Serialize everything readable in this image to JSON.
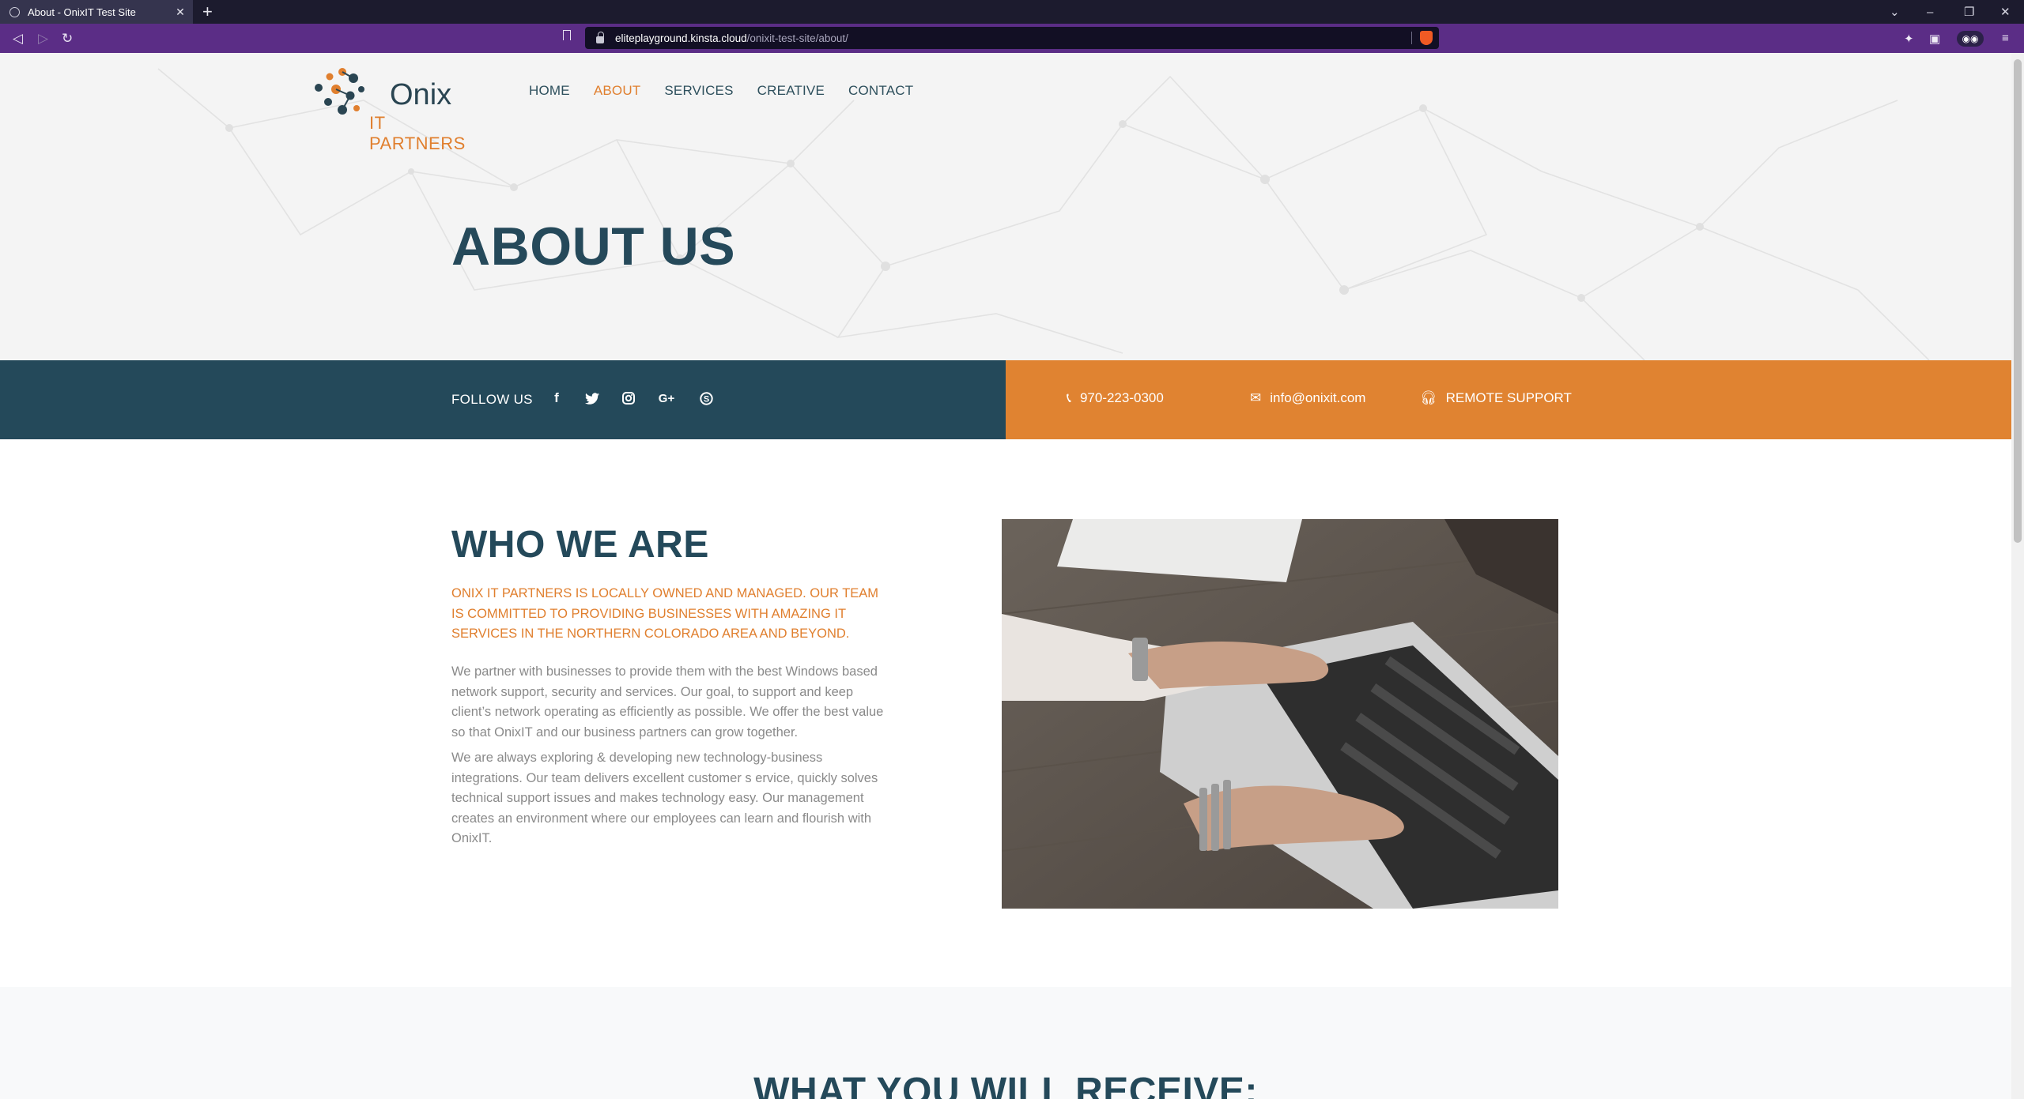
{
  "browser": {
    "tab_title": "About - OnixIT Test Site",
    "url_host": "eliteplayground.kinsta.cloud",
    "url_path": "/onixit-test-site/about/"
  },
  "logo": {
    "word1": "Onix",
    "word2": "IT PARTNERS"
  },
  "nav": {
    "items": [
      "HOME",
      "ABOUT",
      "SERVICES",
      "CREATIVE",
      "CONTACT"
    ],
    "active": "ABOUT"
  },
  "hero": {
    "title": "ABOUT US"
  },
  "strip": {
    "follow_label": "FOLLOW US",
    "social_icons": [
      "facebook-icon",
      "twitter-icon",
      "instagram-icon",
      "google-plus-icon",
      "skype-icon"
    ],
    "phone": "970-223-0300",
    "email": "info@onixit.com",
    "remote_support": "REMOTE SUPPORT"
  },
  "who": {
    "title": "WHO WE ARE",
    "lead": "ONIX IT PARTNERS IS LOCALLY OWNED AND MANAGED. OUR TEAM IS COMMITTED TO PROVIDING BUSINESSES WITH AMAZING IT SERVICES IN THE NORTHERN COLORADO AREA AND BEYOND.",
    "para1": "We partner with businesses to provide them with the best Windows based network support, security and services. Our goal, to support and keep client’s network operating as efficiently as possible. We offer the best value so that OnixIT and our business partners can grow together.",
    "para2": "We are always exploring & developing new technology-business integrations. Our team delivers excellent customer s ervice, quickly solves technical support issues and makes technology easy. Our management creates an environment where our employees can learn and flourish with OnixIT."
  },
  "receive": {
    "title": "WHAT YOU WILL RECEIVE:"
  },
  "colors": {
    "navy": "#24495a",
    "orange": "#e08331",
    "browser_toolbar": "#5b2d86"
  }
}
